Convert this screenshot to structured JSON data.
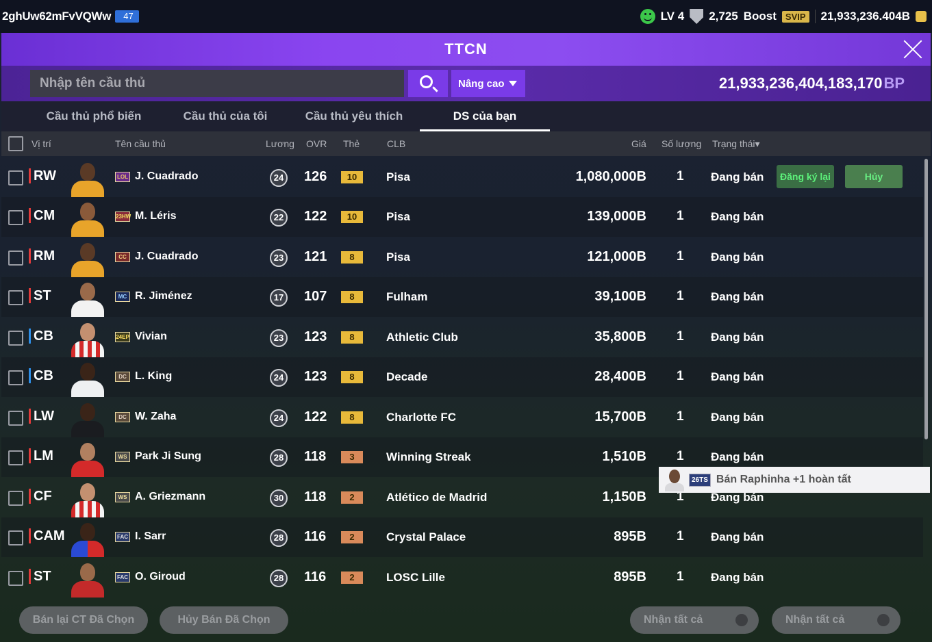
{
  "topbar": {
    "user_id": "2ghUw62mFvVQWw",
    "user_level": "47",
    "level": "LV 4",
    "trophies": "2,725",
    "boost": "Boost",
    "svip": "SVIP",
    "balance": "21,933,236.404B"
  },
  "title": "TTCN",
  "search": {
    "placeholder": "Nhập tên cầu thủ",
    "advanced_label": "Nâng cao",
    "bp_amount": "21,933,236,404,183,170",
    "bp_unit": "BP"
  },
  "tabs": [
    "Cầu thủ phổ biến",
    "Cầu thủ của tôi",
    "Cầu thủ yêu thích",
    "DS của bạn"
  ],
  "active_tab": 3,
  "columns": {
    "position": "Vị trí",
    "name": "Tên cầu thủ",
    "wage": "Lương",
    "ovr": "OVR",
    "card": "Thẻ",
    "club": "CLB",
    "price": "Giá",
    "quantity": "Số lượng",
    "status": "Trạng thái▾"
  },
  "rows": [
    {
      "pos": "RW",
      "season": "LOL",
      "name": "J. Cuadrado",
      "wage": "24",
      "ovr": "126",
      "grade": "10",
      "club": "Pisa",
      "price": "1,080,000B",
      "qty": "1",
      "status": "Đang bán"
    },
    {
      "pos": "CM",
      "season": "23HW",
      "name": "M. Léris",
      "wage": "22",
      "ovr": "122",
      "grade": "10",
      "club": "Pisa",
      "price": "139,000B",
      "qty": "1",
      "status": "Đang bán"
    },
    {
      "pos": "RM",
      "season": "CC",
      "name": "J. Cuadrado",
      "wage": "23",
      "ovr": "121",
      "grade": "8",
      "club": "Pisa",
      "price": "121,000B",
      "qty": "1",
      "status": "Đang bán"
    },
    {
      "pos": "ST",
      "season": "MC",
      "name": "R. Jiménez",
      "wage": "17",
      "ovr": "107",
      "grade": "8",
      "club": "Fulham",
      "price": "39,100B",
      "qty": "1",
      "status": "Đang bán"
    },
    {
      "pos": "CB",
      "season": "24EP",
      "name": "Vivian",
      "wage": "23",
      "ovr": "123",
      "grade": "8",
      "club": "Athletic Club",
      "price": "35,800B",
      "qty": "1",
      "status": "Đang bán"
    },
    {
      "pos": "CB",
      "season": "DC",
      "name": "L. King",
      "wage": "24",
      "ovr": "123",
      "grade": "8",
      "club": "Decade",
      "price": "28,400B",
      "qty": "1",
      "status": "Đang bán"
    },
    {
      "pos": "LW",
      "season": "DC",
      "name": "W. Zaha",
      "wage": "24",
      "ovr": "122",
      "grade": "8",
      "club": "Charlotte FC",
      "price": "15,700B",
      "qty": "1",
      "status": "Đang bán"
    },
    {
      "pos": "LM",
      "season": "WS",
      "name": "Park Ji Sung",
      "wage": "28",
      "ovr": "118",
      "grade": "3",
      "club": "Winning Streak",
      "price": "1,510B",
      "qty": "1",
      "status": "Đang bán"
    },
    {
      "pos": "CF",
      "season": "WS",
      "name": "A. Griezmann",
      "wage": "30",
      "ovr": "118",
      "grade": "2",
      "club": "Atlético de Madrid",
      "price": "1,150B",
      "qty": "1",
      "status": "Đang bán"
    },
    {
      "pos": "CAM",
      "season": "FAC",
      "name": "I. Sarr",
      "wage": "28",
      "ovr": "116",
      "grade": "2",
      "club": "Crystal Palace",
      "price": "895B",
      "qty": "1",
      "status": "Đang bán"
    },
    {
      "pos": "ST",
      "season": "FAC",
      "name": "O. Giroud",
      "wage": "28",
      "ovr": "116",
      "grade": "2",
      "club": "LOSC Lille",
      "price": "895B",
      "qty": "1",
      "status": "Đang bán"
    }
  ],
  "row_actions": {
    "reregister": "Đăng ký lại",
    "cancel": "Hủy"
  },
  "toast": {
    "season": "26TS",
    "message": "Bán Raphinha +1 hoàn tất"
  },
  "bottom": {
    "resell": "Bán lại CT Đã Chọn",
    "cancel_selected": "Hủy Bán Đã Chọn",
    "claim_all_1": "Nhận tất cả",
    "claim_all_2": "Nhận tất cả"
  },
  "colors": {
    "accent": "#7a3be8",
    "title_purple": "#8a45f0",
    "grade_gold": "#e8b93a",
    "grade_bronze": "#d98a5a",
    "position_red": "#e23b3b",
    "position_blue": "#2f8fe8"
  }
}
